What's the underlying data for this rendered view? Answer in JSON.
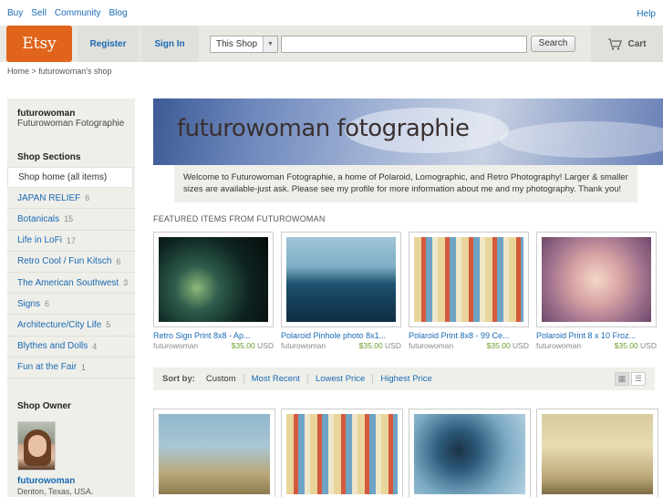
{
  "topnav": {
    "links": [
      "Buy",
      "Sell",
      "Community",
      "Blog"
    ],
    "help": "Help"
  },
  "header": {
    "logo": "Etsy",
    "register": "Register",
    "signin": "Sign In",
    "scope_select": "This Shop",
    "search_placeholder": "",
    "search_button": "Search",
    "cart": "Cart"
  },
  "breadcrumb": "Home > futurowoman's shop",
  "sidebar": {
    "shop_name": "futurowoman",
    "shop_subtitle": "Futurowoman Fotographie",
    "sections_title": "Shop Sections",
    "sections": [
      {
        "label": "Shop home (all items)",
        "count": ""
      },
      {
        "label": "JAPAN RELIEF",
        "count": "6"
      },
      {
        "label": "Botanicals",
        "count": "15"
      },
      {
        "label": "Life in LoFi",
        "count": "17"
      },
      {
        "label": "Retro Cool / Fun Kitsch",
        "count": "6"
      },
      {
        "label": "The American Southwest",
        "count": "3"
      },
      {
        "label": "Signs",
        "count": "6"
      },
      {
        "label": "Architecture/City Life",
        "count": "5"
      },
      {
        "label": "Blythes and Dolls",
        "count": "4"
      },
      {
        "label": "Fun at the Fair",
        "count": "1"
      }
    ],
    "owner_title": "Shop Owner",
    "owner_name": "futurowoman",
    "owner_location": "Denton, Texas, USA."
  },
  "banner": {
    "title": "futurowoman fotographie",
    "welcome": "Welcome to Futurowoman Fotographie, a home of Polaroid, Lomographic, and Retro Photography! Larger & smaller sizes are available-just ask. Please see my profile for more information about me and my photography. Thank you!"
  },
  "featured": {
    "title": "FEATURED ITEMS FROM FUTUROWOMAN",
    "items": [
      {
        "title": "Retro Sign Print 8x8 - Ap...",
        "seller": "futurowoman",
        "price": "$35.00",
        "currency": "USD"
      },
      {
        "title": "Polaroid Pinhole photo 8x1...",
        "seller": "futurowoman",
        "price": "$35.00",
        "currency": "USD"
      },
      {
        "title": "Polaroid Print 8x8 - 99 Ce...",
        "seller": "futurowoman",
        "price": "$35.00",
        "currency": "USD"
      },
      {
        "title": "Polaroid Print 8 x 10 Froz...",
        "seller": "futurowoman",
        "price": "$35.00",
        "currency": "USD"
      }
    ]
  },
  "sortbar": {
    "label": "Sort by:",
    "options": [
      "Custom",
      "Most Recent",
      "Lowest Price",
      "Highest Price"
    ]
  }
}
